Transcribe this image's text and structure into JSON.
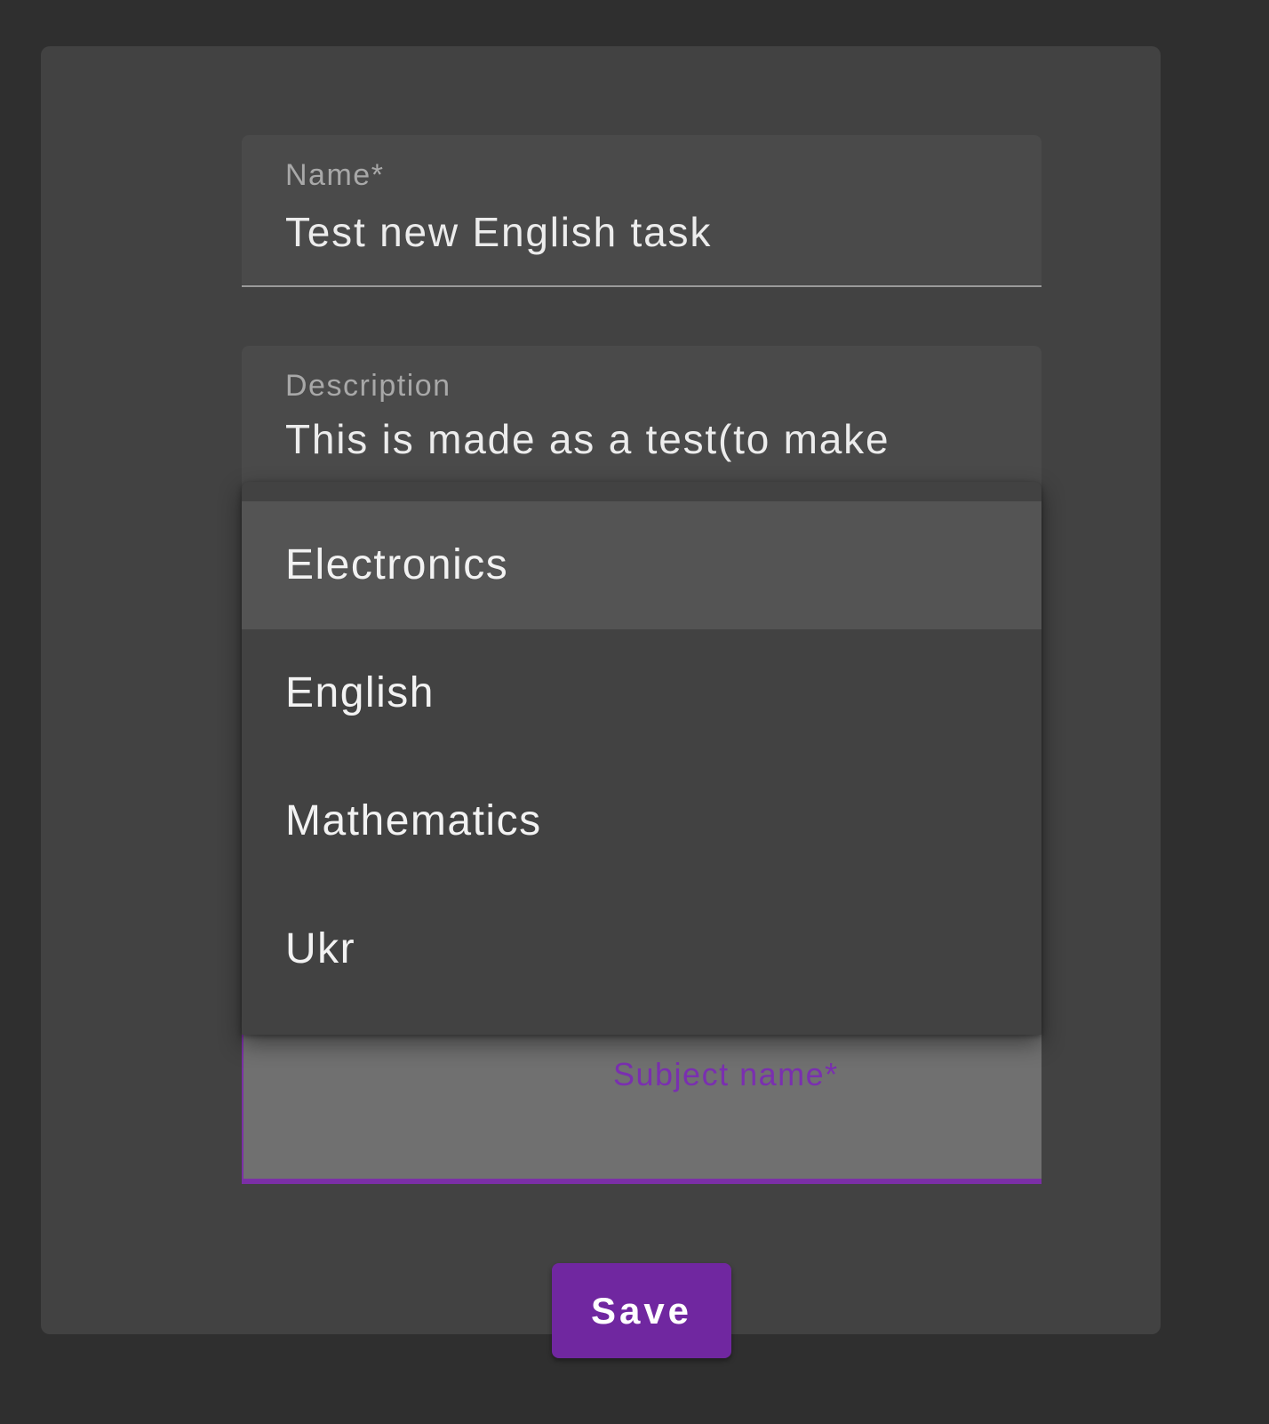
{
  "form": {
    "name_field": {
      "label": "Name*",
      "value": "Test new English task"
    },
    "description_field": {
      "label": "Description",
      "value": "This is made as a test(to make"
    },
    "subject_field": {
      "label": "Subject name*",
      "value": ""
    },
    "subject_dropdown": {
      "options": [
        "Electronics",
        "English",
        "Mathematics",
        "Ukr"
      ],
      "highlighted": "Electronics"
    },
    "save_button_label": "Save"
  },
  "colors": {
    "accent": "#7027a0",
    "background": "#2f2f2f",
    "card": "#424242"
  }
}
